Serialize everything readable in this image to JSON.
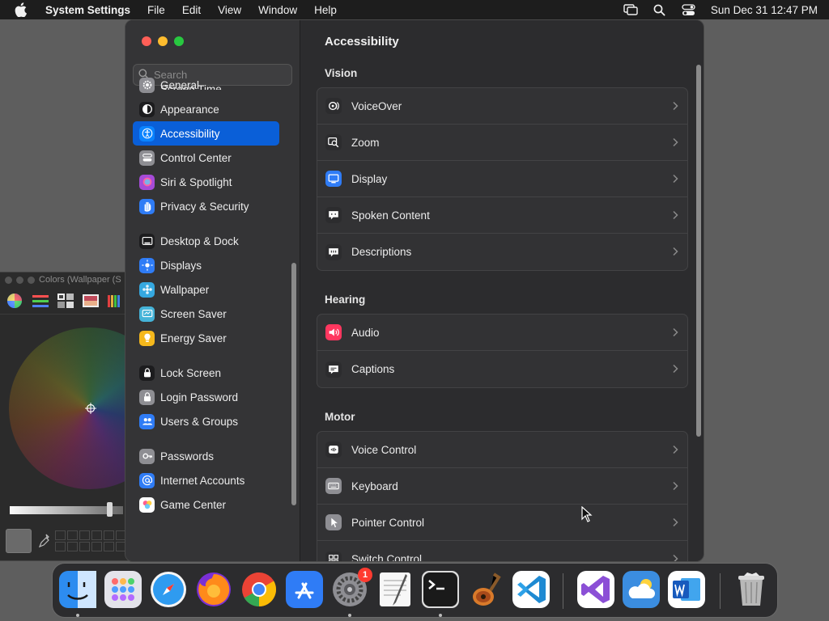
{
  "menubar": {
    "app_name": "System Settings",
    "menus": [
      "File",
      "Edit",
      "View",
      "Window",
      "Help"
    ],
    "clock": "Sun Dec 31  12:47 PM"
  },
  "colors_panel": {
    "title": "Colors (Wallpaper (S"
  },
  "sidebar": {
    "search_placeholder": "Search",
    "partial_item": "Screen Time",
    "items": [
      {
        "label": "General",
        "color": "#8e8e93",
        "icon": "gear-icon"
      },
      {
        "label": "Appearance",
        "color": "#1c1c1e",
        "icon": "appearance-icon"
      },
      {
        "label": "Accessibility",
        "color": "#0a84ff",
        "icon": "accessibility-icon",
        "selected": true
      },
      {
        "label": "Control Center",
        "color": "#8e8e93",
        "icon": "control-center-icon"
      },
      {
        "label": "Siri & Spotlight",
        "color": "#a64bd8",
        "icon": "siri-icon"
      },
      {
        "label": "Privacy & Security",
        "color": "#2f7cf6",
        "icon": "hand-icon"
      },
      {
        "label": "Desktop & Dock",
        "color": "#1c1c1e",
        "icon": "dock-icon"
      },
      {
        "label": "Displays",
        "color": "#2f7cf6",
        "icon": "displays-icon"
      },
      {
        "label": "Wallpaper",
        "color": "#35a8e0",
        "icon": "wallpaper-icon"
      },
      {
        "label": "Screen Saver",
        "color": "#45b3d8",
        "icon": "screen-saver-icon"
      },
      {
        "label": "Energy Saver",
        "color": "#f5b81c",
        "icon": "bulb-icon"
      },
      {
        "label": "Lock Screen",
        "color": "#1c1c1e",
        "icon": "lock-icon"
      },
      {
        "label": "Login Password",
        "color": "#8e8e93",
        "icon": "padlock-icon"
      },
      {
        "label": "Users & Groups",
        "color": "#2f7cf6",
        "icon": "users-icon"
      },
      {
        "label": "Passwords",
        "color": "#8e8e93",
        "icon": "key-icon"
      },
      {
        "label": "Internet Accounts",
        "color": "#2f7cf6",
        "icon": "at-icon"
      },
      {
        "label": "Game Center",
        "color": "#ffffff",
        "icon": "game-center-icon"
      }
    ]
  },
  "content": {
    "title": "Accessibility",
    "sections": [
      {
        "title": "Vision",
        "rows": [
          {
            "label": "VoiceOver",
            "icon": "voiceover-icon",
            "color": "#2c2c2e"
          },
          {
            "label": "Zoom",
            "icon": "zoom-icon",
            "color": "#2c2c2e"
          },
          {
            "label": "Display",
            "icon": "display-icon",
            "color": "#2f7cf6"
          },
          {
            "label": "Spoken Content",
            "icon": "spoken-content-icon",
            "color": "#2c2c2e"
          },
          {
            "label": "Descriptions",
            "icon": "descriptions-icon",
            "color": "#2c2c2e"
          }
        ]
      },
      {
        "title": "Hearing",
        "rows": [
          {
            "label": "Audio",
            "icon": "speaker-icon",
            "color": "#ff375f"
          },
          {
            "label": "Captions",
            "icon": "captions-icon",
            "color": "#2c2c2e"
          }
        ]
      },
      {
        "title": "Motor",
        "rows": [
          {
            "label": "Voice Control",
            "icon": "voice-control-icon",
            "color": "#2c2c2e"
          },
          {
            "label": "Keyboard",
            "icon": "keyboard-icon",
            "color": "#8e8e93"
          },
          {
            "label": "Pointer Control",
            "icon": "pointer-icon",
            "color": "#8e8e93"
          },
          {
            "label": "Switch Control",
            "icon": "switch-control-icon",
            "color": "#2c2c2e"
          }
        ]
      }
    ]
  },
  "dock": {
    "apps": [
      {
        "name": "finder",
        "color": "#2d8cf0",
        "running": true
      },
      {
        "name": "launchpad",
        "color": "#d9d9e0"
      },
      {
        "name": "safari",
        "color": "#2f9bf0"
      },
      {
        "name": "firefox",
        "color": "#ff7a1a"
      },
      {
        "name": "chrome",
        "color": "#e8e8e8"
      },
      {
        "name": "app-store",
        "color": "#2f7cf6"
      },
      {
        "name": "system-settings",
        "color": "#8e8e93",
        "running": true,
        "badge": "1"
      },
      {
        "name": "textedit",
        "color": "#f4f4f4"
      },
      {
        "name": "terminal",
        "color": "#1a1a1a",
        "running": true
      },
      {
        "name": "garageband",
        "color": "#3a2a1a"
      },
      {
        "name": "vscode",
        "color": "#ffffff"
      },
      {
        "name": "visual-studio",
        "color": "#ffffff"
      },
      {
        "name": "weather",
        "color": "#3b8de0"
      },
      {
        "name": "word",
        "color": "#ffffff"
      },
      {
        "name": "trash",
        "color": "#9a9a9a"
      }
    ]
  }
}
